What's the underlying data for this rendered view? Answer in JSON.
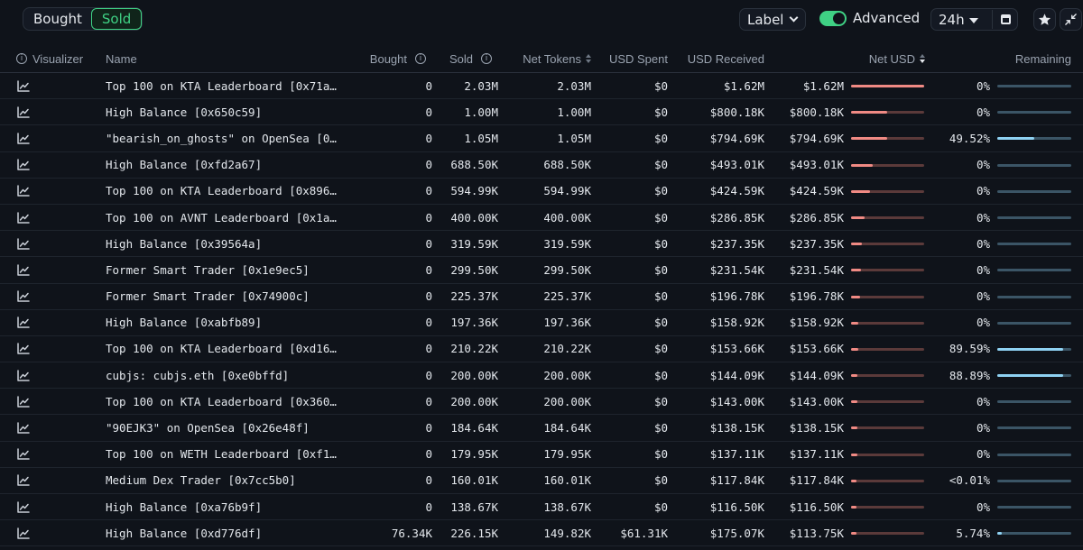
{
  "tabs": {
    "bought": "Bought",
    "sold": "Sold"
  },
  "controls": {
    "label_dropdown": "Label",
    "advanced_label": "Advanced",
    "advanced_on": true,
    "timeframe": "24h"
  },
  "icons": {
    "calendar": "calendar-icon",
    "star": "star-icon",
    "collapse": "collapse-icon",
    "chart": "chart-line-icon",
    "info": "info-icon"
  },
  "colors": {
    "accent": "#3fd184",
    "bar_fill": "#f08a84",
    "bar_track": "#5b3a3a",
    "remaining_fill": "#8fd2f3",
    "remaining_track": "#3b5566"
  },
  "columns": {
    "visualizer": "Visualizer",
    "name": "Name",
    "bought": "Bought",
    "sold": "Sold",
    "net_tokens": "Net Tokens",
    "usd_spent": "USD Spent",
    "usd_received": "USD Received",
    "net_usd": "Net USD",
    "remaining": "Remaining"
  },
  "rows": [
    {
      "name": "Top 100 on KTA Leaderboard [0x71a…",
      "bought": "0",
      "sold": "2.03M",
      "net_tokens": "2.03M",
      "usd_spent": "$0",
      "usd_received": "$1.62M",
      "net_usd": "$1.62M",
      "net_usd_bar": 1.0,
      "remaining": "0%",
      "remaining_bar": 0.0
    },
    {
      "name": "High Balance [0x650c59]",
      "bought": "0",
      "sold": "1.00M",
      "net_tokens": "1.00M",
      "usd_spent": "$0",
      "usd_received": "$800.18K",
      "net_usd": "$800.18K",
      "net_usd_bar": 0.49,
      "remaining": "0%",
      "remaining_bar": 0.0
    },
    {
      "name": "\"bearish_on_ghosts\" on OpenSea [0…",
      "bought": "0",
      "sold": "1.05M",
      "net_tokens": "1.05M",
      "usd_spent": "$0",
      "usd_received": "$794.69K",
      "net_usd": "$794.69K",
      "net_usd_bar": 0.49,
      "remaining": "49.52%",
      "remaining_bar": 0.4952
    },
    {
      "name": "High Balance [0xfd2a67]",
      "bought": "0",
      "sold": "688.50K",
      "net_tokens": "688.50K",
      "usd_spent": "$0",
      "usd_received": "$493.01K",
      "net_usd": "$493.01K",
      "net_usd_bar": 0.3,
      "remaining": "0%",
      "remaining_bar": 0.0
    },
    {
      "name": "Top 100 on KTA Leaderboard [0x896…",
      "bought": "0",
      "sold": "594.99K",
      "net_tokens": "594.99K",
      "usd_spent": "$0",
      "usd_received": "$424.59K",
      "net_usd": "$424.59K",
      "net_usd_bar": 0.26,
      "remaining": "0%",
      "remaining_bar": 0.0
    },
    {
      "name": "Top 100 on AVNT Leaderboard [0x1a…",
      "bought": "0",
      "sold": "400.00K",
      "net_tokens": "400.00K",
      "usd_spent": "$0",
      "usd_received": "$286.85K",
      "net_usd": "$286.85K",
      "net_usd_bar": 0.18,
      "remaining": "0%",
      "remaining_bar": 0.0
    },
    {
      "name": "High Balance [0x39564a]",
      "bought": "0",
      "sold": "319.59K",
      "net_tokens": "319.59K",
      "usd_spent": "$0",
      "usd_received": "$237.35K",
      "net_usd": "$237.35K",
      "net_usd_bar": 0.15,
      "remaining": "0%",
      "remaining_bar": 0.0
    },
    {
      "name": "Former Smart Trader [0x1e9ec5]",
      "bought": "0",
      "sold": "299.50K",
      "net_tokens": "299.50K",
      "usd_spent": "$0",
      "usd_received": "$231.54K",
      "net_usd": "$231.54K",
      "net_usd_bar": 0.14,
      "remaining": "0%",
      "remaining_bar": 0.0
    },
    {
      "name": "Former Smart Trader [0x74900c]",
      "bought": "0",
      "sold": "225.37K",
      "net_tokens": "225.37K",
      "usd_spent": "$0",
      "usd_received": "$196.78K",
      "net_usd": "$196.78K",
      "net_usd_bar": 0.12,
      "remaining": "0%",
      "remaining_bar": 0.0
    },
    {
      "name": "High Balance [0xabfb89]",
      "bought": "0",
      "sold": "197.36K",
      "net_tokens": "197.36K",
      "usd_spent": "$0",
      "usd_received": "$158.92K",
      "net_usd": "$158.92K",
      "net_usd_bar": 0.1,
      "remaining": "0%",
      "remaining_bar": 0.0
    },
    {
      "name": "Top 100 on KTA Leaderboard [0xd16…",
      "bought": "0",
      "sold": "210.22K",
      "net_tokens": "210.22K",
      "usd_spent": "$0",
      "usd_received": "$153.66K",
      "net_usd": "$153.66K",
      "net_usd_bar": 0.095,
      "remaining": "89.59%",
      "remaining_bar": 0.8959
    },
    {
      "name": "cubjs: cubjs.eth [0xe0bffd]",
      "bought": "0",
      "sold": "200.00K",
      "net_tokens": "200.00K",
      "usd_spent": "$0",
      "usd_received": "$144.09K",
      "net_usd": "$144.09K",
      "net_usd_bar": 0.089,
      "remaining": "88.89%",
      "remaining_bar": 0.8889
    },
    {
      "name": "Top 100 on KTA Leaderboard [0x360…",
      "bought": "0",
      "sold": "200.00K",
      "net_tokens": "200.00K",
      "usd_spent": "$0",
      "usd_received": "$143.00K",
      "net_usd": "$143.00K",
      "net_usd_bar": 0.088,
      "remaining": "0%",
      "remaining_bar": 0.0
    },
    {
      "name": "\"90EJK3\" on OpenSea [0x26e48f]",
      "bought": "0",
      "sold": "184.64K",
      "net_tokens": "184.64K",
      "usd_spent": "$0",
      "usd_received": "$138.15K",
      "net_usd": "$138.15K",
      "net_usd_bar": 0.085,
      "remaining": "0%",
      "remaining_bar": 0.0
    },
    {
      "name": "Top 100 on WETH Leaderboard [0xf1…",
      "bought": "0",
      "sold": "179.95K",
      "net_tokens": "179.95K",
      "usd_spent": "$0",
      "usd_received": "$137.11K",
      "net_usd": "$137.11K",
      "net_usd_bar": 0.085,
      "remaining": "0%",
      "remaining_bar": 0.0
    },
    {
      "name": "Medium Dex Trader [0x7cc5b0]",
      "bought": "0",
      "sold": "160.01K",
      "net_tokens": "160.01K",
      "usd_spent": "$0",
      "usd_received": "$117.84K",
      "net_usd": "$117.84K",
      "net_usd_bar": 0.073,
      "remaining": "<0.01%",
      "remaining_bar": 0.0
    },
    {
      "name": "High Balance [0xa76b9f]",
      "bought": "0",
      "sold": "138.67K",
      "net_tokens": "138.67K",
      "usd_spent": "$0",
      "usd_received": "$116.50K",
      "net_usd": "$116.50K",
      "net_usd_bar": 0.072,
      "remaining": "0%",
      "remaining_bar": 0.0
    },
    {
      "name": "High Balance [0xd776df]",
      "bought": "76.34K",
      "sold": "226.15K",
      "net_tokens": "149.82K",
      "usd_spent": "$61.31K",
      "usd_received": "$175.07K",
      "net_usd": "$113.75K",
      "net_usd_bar": 0.07,
      "remaining": "5.74%",
      "remaining_bar": 0.0574
    }
  ]
}
